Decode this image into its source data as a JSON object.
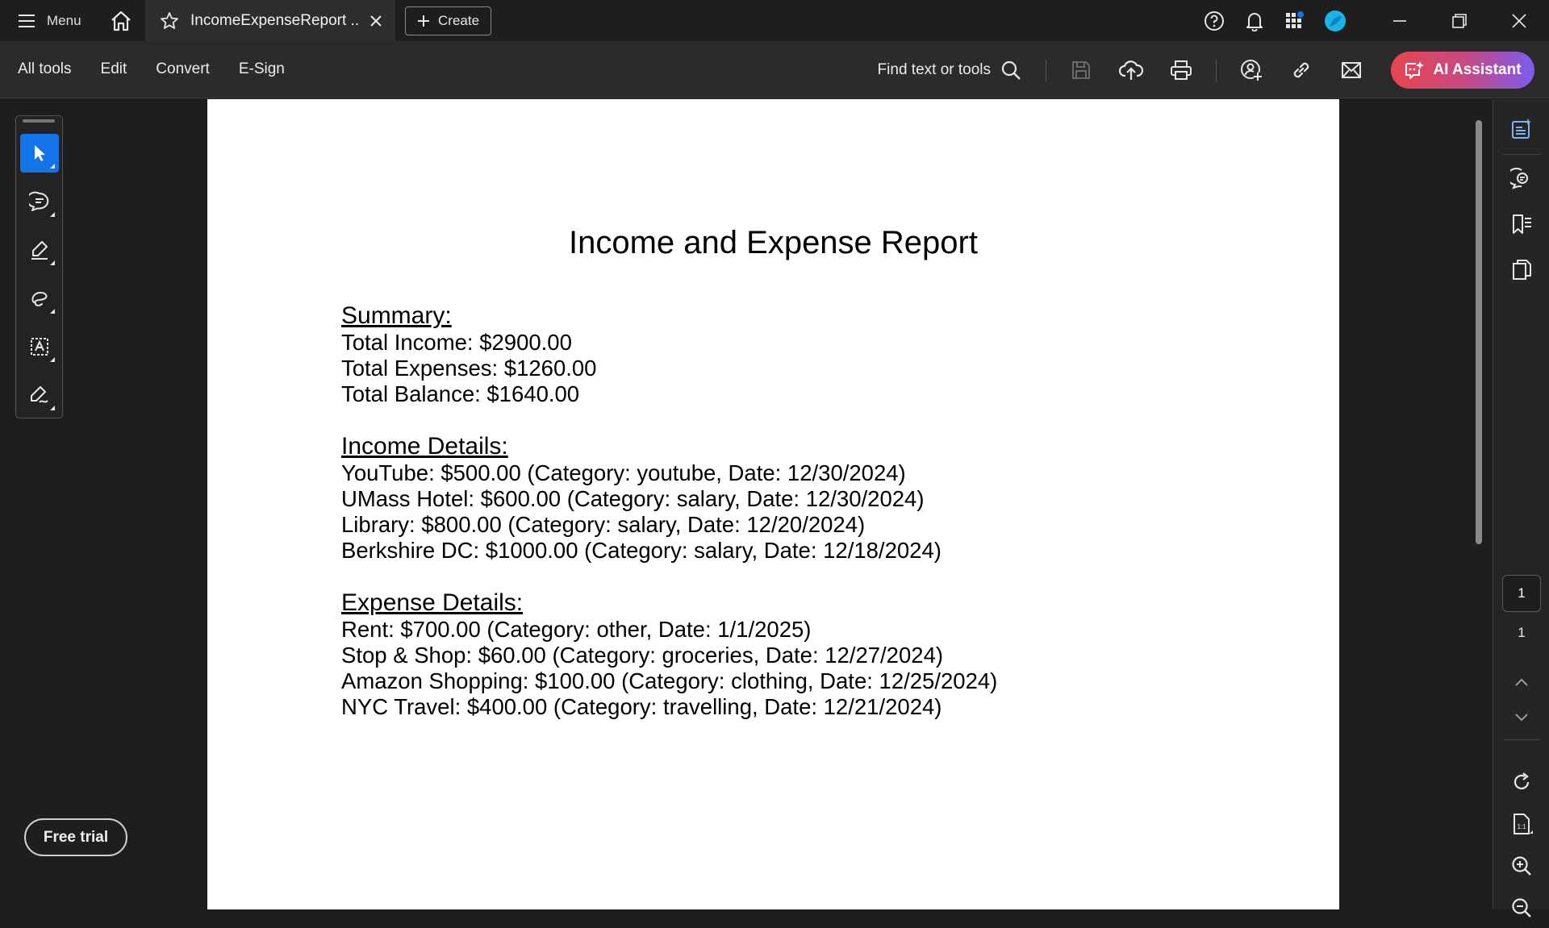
{
  "titlebar": {
    "menu_label": "Menu",
    "tab_label": "IncomeExpenseReport ...",
    "create_label": "Create",
    "accent_color": "#1473e6"
  },
  "toolbar": {
    "menu_items": [
      "All tools",
      "Edit",
      "Convert",
      "E-Sign"
    ],
    "find_label": "Find text or tools",
    "ai_label": "AI Assistant"
  },
  "sidebar": {
    "free_trial_label": "Free trial"
  },
  "document": {
    "title": "Income and Expense Report",
    "summary": {
      "heading": "Summary:",
      "lines": [
        "Total Income: $2900.00",
        "Total Expenses: $1260.00",
        "Total Balance: $1640.00"
      ]
    },
    "income": {
      "heading": "Income Details:",
      "lines": [
        "YouTube: $500.00 (Category: youtube, Date: 12/30/2024)",
        "UMass Hotel: $600.00 (Category: salary, Date: 12/30/2024)",
        "Library: $800.00 (Category: salary, Date: 12/20/2024)",
        "Berkshire DC: $1000.00 (Category: salary, Date: 12/18/2024)"
      ]
    },
    "expense": {
      "heading": "Expense Details:",
      "lines": [
        "Rent: $700.00 (Category: other, Date: 1/1/2025)",
        "Stop & Shop: $60.00 (Category: groceries, Date: 12/27/2024)",
        "Amazon Shopping: $100.00 (Category: clothing, Date: 12/25/2024)",
        "NYC Travel: $400.00 (Category: travelling, Date: 12/21/2024)"
      ]
    }
  },
  "pager": {
    "current_page": "1",
    "total_pages": "1"
  }
}
